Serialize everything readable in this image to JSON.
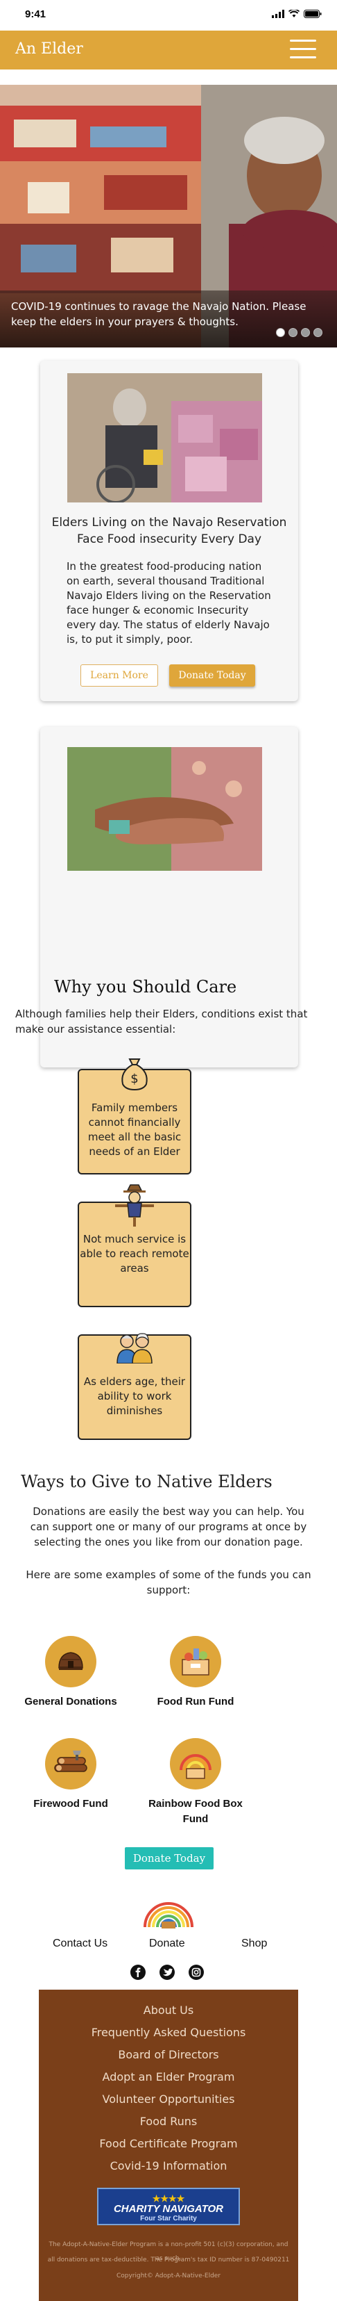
{
  "status_bar": {
    "time": "9:41"
  },
  "header": {
    "title": "An Elder"
  },
  "hero": {
    "caption": "COVID-19 continues to ravage the Navajo Nation. Please keep the elders in your prayers & thoughts.",
    "slide_count": 4,
    "active_slide": 1
  },
  "feature_card": {
    "title": "Elders Living on the Navajo Reservation Face Food insecurity Every Day",
    "body": "In the greatest food-producing nation on earth, several thousand Traditional Navajo Elders living on the Reservation face hunger & economic Insecurity every day. The status of elderly Navajo is, to put it simply, poor.",
    "learn_more": "Learn More",
    "donate_today": "Donate Today"
  },
  "care": {
    "title": "Why you Should Care",
    "text": "Although families help their Elders, conditions exist that make our assistance essential:",
    "needs": [
      {
        "icon": "money-bag-icon",
        "text": "Family members cannot financially meet all the basic needs of an Elder"
      },
      {
        "icon": "scarecrow-icon",
        "text": "Not much service is able to reach remote areas"
      },
      {
        "icon": "elderly-couple-icon",
        "text": "As elders age, their ability to work diminishes"
      }
    ]
  },
  "ways": {
    "title": "Ways to Give to Native Elders",
    "paragraph1": "Donations are easily the best way you can help. You can support one or many of our programs at once by selecting the ones you like from our donation page.",
    "paragraph2": "Here are some examples of some of the funds you can support:",
    "funds": [
      {
        "icon": "hogan-icon",
        "label": "General Donations"
      },
      {
        "icon": "food-box-icon",
        "label": "Food Run Fund"
      },
      {
        "icon": "firewood-icon",
        "label": "Firewood Fund"
      },
      {
        "icon": "rainbow-icon",
        "label": "Rainbow Food Box Fund"
      }
    ],
    "donate_button": "Donate Today"
  },
  "footer_nav": {
    "contact": "Contact Us",
    "donate": "Donate",
    "shop": "Shop"
  },
  "social": [
    "facebook-icon",
    "twitter-icon",
    "instagram-icon"
  ],
  "bottom_footer": {
    "links": [
      "About Us",
      "Frequently Asked Questions",
      "Board of Directors",
      "Adopt an Elder Program",
      "Volunteer Opportunities",
      "Food Runs",
      "Food Certificate Program",
      "Covid-19 Information"
    ],
    "charity": {
      "stars": "★★★★",
      "name": "CHARITY NAVIGATOR",
      "sub": "Four Star Charity"
    },
    "fine_line1": "The Adopt-A-Native-Elder Program is a non-profit 501 (c)(3) corporation, and as such,",
    "fine_line2": "all donations are tax-deductible. The Program's tax ID number is 87-0490211",
    "copyright": "Copyright© Adopt-A-Native-Elder"
  },
  "colors": {
    "gold": "#dfa63a",
    "teal": "#24bdb4",
    "footer_brown": "#7a3f19",
    "need_box": "#f3cf8b"
  }
}
